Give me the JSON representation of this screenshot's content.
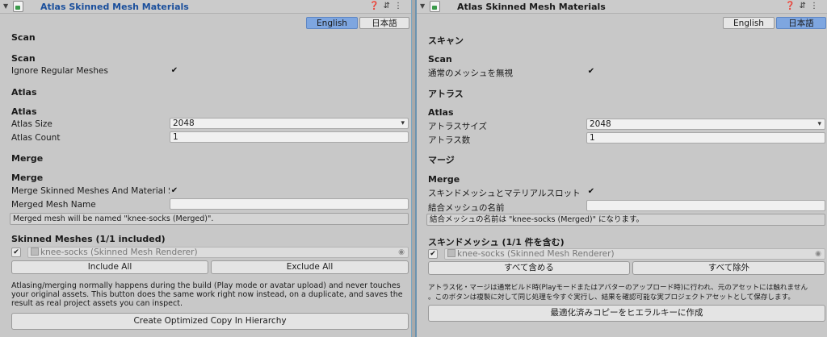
{
  "en": {
    "title": "Atlas Skinned Mesh Materials",
    "lang_en": "English",
    "lang_ja": "日本語",
    "section_scan": "Scan",
    "sub_scan": "Scan",
    "ignore_regular": "Ignore Regular Meshes",
    "section_atlas": "Atlas",
    "sub_atlas": "Atlas",
    "atlas_size": "Atlas Size",
    "atlas_size_value": "2048",
    "atlas_count": "Atlas Count",
    "atlas_count_value": "1",
    "section_merge": "Merge",
    "sub_merge": "Merge",
    "merge_skinned": "Merge Skinned Meshes And Material Sl",
    "merged_mesh_name": "Merged Mesh Name",
    "merged_mesh_name_value": "",
    "merged_note": "Merged mesh will be named \"knee-socks (Merged)\".",
    "skinned_meshes": "Skinned Meshes (1/1 included)",
    "mesh_item": "knee-socks (Skinned Mesh Renderer)",
    "include_all": "Include All",
    "exclude_all": "Exclude All",
    "description": "Atlasing/merging normally happens during the build (Play mode or avatar upload) and never touches your original assets. This button does the same work right now instead, on a duplicate, and saves the result as real project assets you can inspect.",
    "create_copy": "Create Optimized Copy In Hierarchy"
  },
  "ja": {
    "title": "Atlas Skinned Mesh Materials",
    "lang_en": "English",
    "lang_ja": "日本語",
    "section_scan": "スキャン",
    "sub_scan": "Scan",
    "ignore_regular": "通常のメッシュを無視",
    "section_atlas": "アトラス",
    "sub_atlas": "Atlas",
    "atlas_size": "アトラスサイズ",
    "atlas_size_value": "2048",
    "atlas_count": "アトラス数",
    "atlas_count_value": "1",
    "section_merge": "マージ",
    "sub_merge": "Merge",
    "merge_skinned": "スキンドメッシュとマテリアルスロット",
    "merged_mesh_name": "結合メッシュの名前",
    "merged_mesh_name_value": "",
    "merged_note": "結合メッシュの名前は \"knee-socks (Merged)\" になります。",
    "skinned_meshes": "スキンドメッシュ (1/1 件を含む)",
    "mesh_item": "knee-socks (Skinned Mesh Renderer)",
    "include_all": "すべて含める",
    "exclude_all": "すべて除外",
    "description_1": "アトラス化・マージは通常ビルド時(Playモードまたはアバターのアップロード時)に行われ、元のアセットには触れません",
    "description_2": "。このボタンは複製に対して同じ処理を今すぐ実行し、結果を確認可能な実プロジェクトアセットとして保存します。",
    "create_copy": "最適化済みコピーをヒエラルキーに作成"
  },
  "icons": {
    "fold": "fold-triangle-icon",
    "script": "script-icon",
    "help": "help-icon",
    "presets": "presets-icon",
    "menu": "kebab-menu-icon",
    "check": "checkmark-icon",
    "dropdown": "dropdown-arrow-icon",
    "object_target": "object-picker-icon"
  },
  "colors": {
    "accent": "#7ea6e0",
    "title_en": "#1a4f9c",
    "panel_bg": "#c8c8c8"
  }
}
